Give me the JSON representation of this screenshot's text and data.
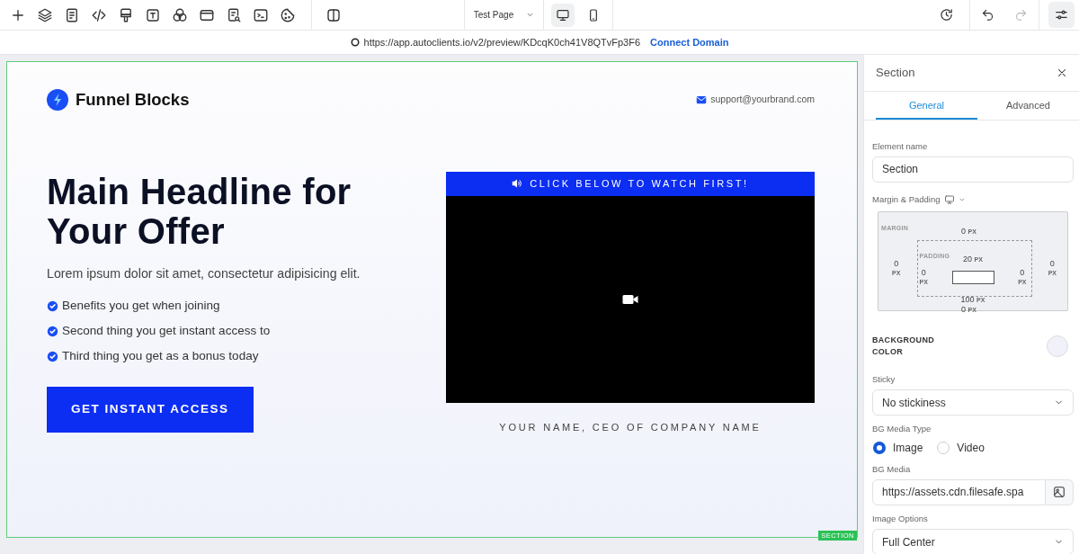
{
  "toolbar": {
    "tools": [
      {
        "kind": "plus"
      },
      {
        "kind": "layers"
      },
      {
        "kind": "document"
      },
      {
        "kind": "code"
      },
      {
        "kind": "roller"
      },
      {
        "kind": "text"
      },
      {
        "kind": "circles"
      },
      {
        "kind": "window"
      },
      {
        "kind": "docsearch"
      },
      {
        "kind": "terminal"
      },
      {
        "kind": "cookie"
      }
    ],
    "page_select": {
      "value": "Test Page"
    },
    "devices": [
      {
        "kind": "desktop",
        "selected": true
      },
      {
        "kind": "mobile",
        "selected": false
      }
    ],
    "history": [
      {
        "kind": "undo",
        "disabled": false
      },
      {
        "kind": "redo",
        "disabled": true
      }
    ]
  },
  "address_bar": {
    "url": "https://app.autoclients.io/v2/preview/KDcqK0ch41V8QTvFp3F6",
    "link": "Connect Domain"
  },
  "canvas": {
    "brand": "Funnel Blocks",
    "email": "support@yourbrand.com",
    "headline": "Main Headline for Your Offer",
    "subheadline": "Lorem ipsum dolor sit amet, consectetur adipisicing elit.",
    "benefits": [
      "Benefits you get when joining",
      "Second thing you get instant access to",
      "Third thing you get as a bonus today"
    ],
    "cta": "GET INSTANT ACCESS",
    "video_banner": "CLICK BELOW TO WATCH FIRST!",
    "caption": "YOUR NAME, CEO OF COMPANY NAME",
    "section_tag": "SECTION"
  },
  "panel": {
    "title": "Section",
    "tabs": [
      {
        "label": "General",
        "selected": true
      },
      {
        "label": "Advanced",
        "selected": false
      }
    ],
    "fields": [
      {
        "kind": "text",
        "label": "Element name",
        "value": "Section"
      },
      {
        "kind": "spacing",
        "label": "Margin & Padding",
        "margin_label": "MARGIN",
        "padding_label": "PADDING",
        "margin": {
          "top": {
            "value": "0",
            "unit": "PX"
          },
          "right": {
            "value": "0",
            "unit": "PX"
          },
          "bottom": {
            "value": "0",
            "unit": "PX"
          },
          "left": {
            "value": "0",
            "unit": "PX"
          }
        },
        "padding": {
          "top": {
            "value": "20",
            "unit": "PX"
          },
          "right": {
            "value": "0",
            "unit": "PX"
          },
          "bottom": {
            "value": "100",
            "unit": "PX"
          },
          "left": {
            "value": "0",
            "unit": "PX"
          }
        }
      },
      {
        "kind": "color",
        "label": "BACKGROUND COLOR",
        "color": "#f1f2f9"
      },
      {
        "kind": "select",
        "label": "Sticky",
        "value": "No stickiness"
      },
      {
        "kind": "radio",
        "label": "BG Media Type",
        "options": [
          {
            "label": "Image",
            "selected": true
          },
          {
            "label": "Video",
            "selected": false
          }
        ]
      },
      {
        "kind": "media",
        "label": "BG Media",
        "value": "https://assets.cdn.filesafe.spa"
      },
      {
        "kind": "select",
        "label": "Image Options",
        "value": "Full Center"
      }
    ]
  }
}
